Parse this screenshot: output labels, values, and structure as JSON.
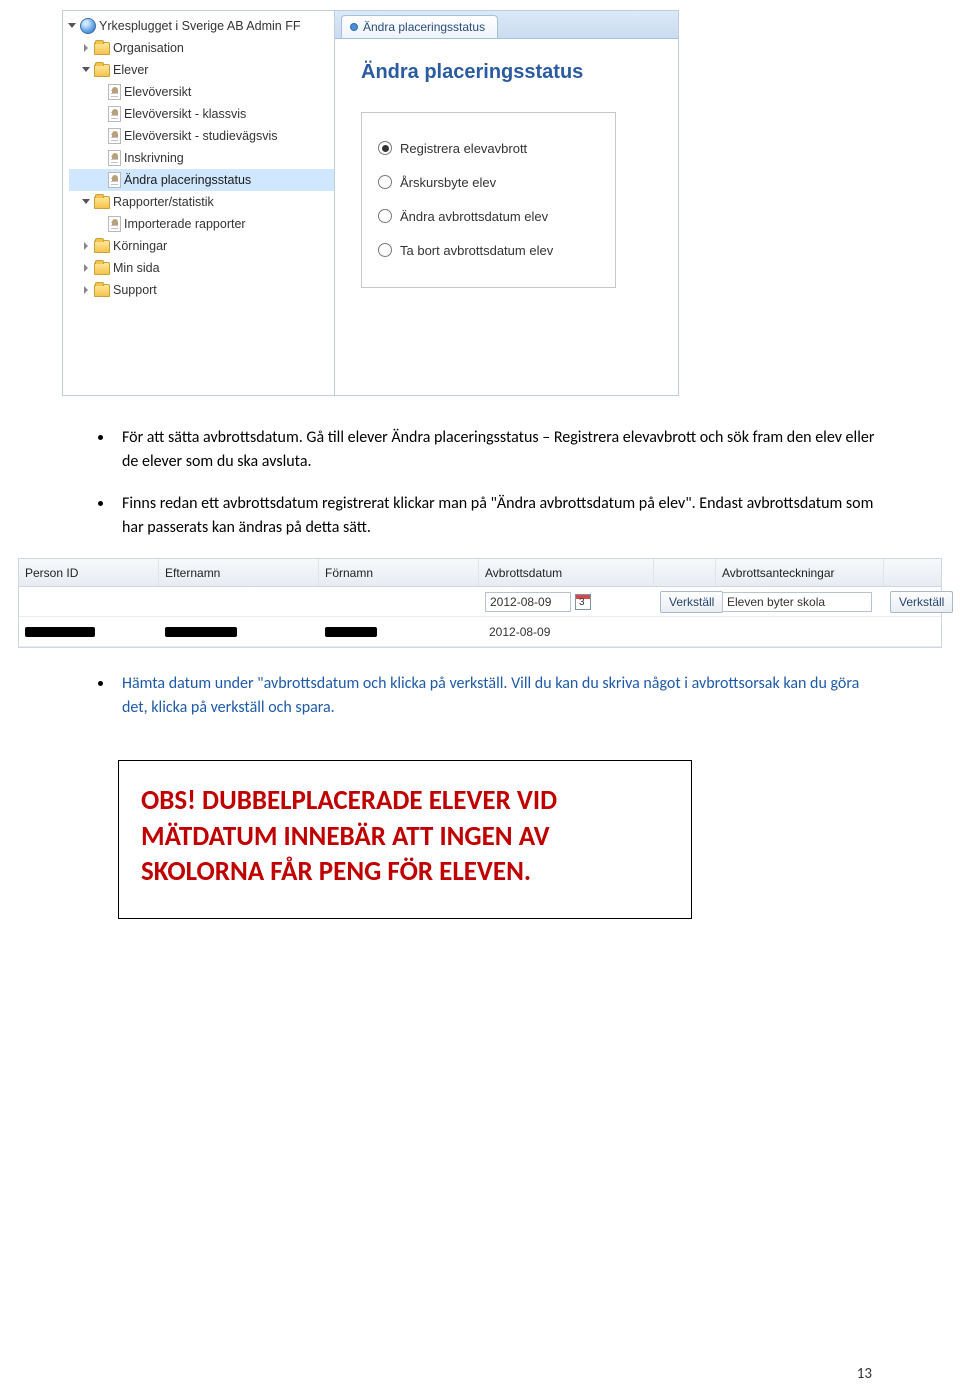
{
  "tree": {
    "root": "Yrkesplugget i Sverige AB Admin FF",
    "items": [
      {
        "label": "Organisation",
        "type": "folder",
        "caret": "right",
        "level": 2
      },
      {
        "label": "Elever",
        "type": "folder",
        "caret": "down",
        "level": 2
      },
      {
        "label": "Elevöversikt",
        "type": "doc",
        "caret": "none",
        "level": 3
      },
      {
        "label": "Elevöversikt - klassvis",
        "type": "doc",
        "caret": "none",
        "level": 3
      },
      {
        "label": "Elevöversikt - studievägsvis",
        "type": "doc",
        "caret": "none",
        "level": 3
      },
      {
        "label": "Inskrivning",
        "type": "doc",
        "caret": "none",
        "level": 3
      },
      {
        "label": "Ändra placeringsstatus",
        "type": "doc",
        "caret": "none",
        "level": 3,
        "selected": 1
      },
      {
        "label": "Rapporter/statistik",
        "type": "folder",
        "caret": "down",
        "level": 2
      },
      {
        "label": "Importerade rapporter",
        "type": "doc",
        "caret": "none",
        "level": 3
      },
      {
        "label": "Körningar",
        "type": "folder",
        "caret": "right",
        "level": 2
      },
      {
        "label": "Min sida",
        "type": "folder",
        "caret": "right",
        "level": 2
      },
      {
        "label": "Support",
        "type": "folder",
        "caret": "right",
        "level": 2
      }
    ]
  },
  "tab": {
    "label": "Ändra placeringsstatus"
  },
  "panel": {
    "title": "Ändra placeringsstatus",
    "radios": [
      {
        "label": "Registrera elevavbrott",
        "on": 1
      },
      {
        "label": "Årskursbyte elev",
        "on": 0
      },
      {
        "label": "Ändra avbrottsdatum elev",
        "on": 0
      },
      {
        "label": "Ta bort avbrottsdatum elev",
        "on": 0
      }
    ]
  },
  "body": {
    "b1": "För att sätta avbrottsdatum. Gå till elever Ändra placeringsstatus – Registrera elevavbrott och sök fram den elev eller de elever som du ska avsluta.",
    "b2": "Finns redan ett avbrottsdatum registrerat klickar man på \"Ändra avbrottsdatum på elev\". Endast avbrottsdatum som har passerats kan ändras på detta sätt.",
    "b3a": "Hämta datum under \"avbrottsdatum och klicka på verkställ. Vill du kan du skriva något i avbrottsorsak kan du göra det, klicka på verkställ och spara.",
    "callout": "OBS! DUBBELPLACERADE ELEVER VID MÄTDATUM INNEBÄR ATT INGEN AV SKOLORNA FÅR PENG FÖR ELEVEN.",
    "page": "13"
  },
  "table": {
    "headers": {
      "personid": "Person ID",
      "efternamn": "Efternamn",
      "fornamn": "Förnamn",
      "avbrottsdatum": "Avbrottsdatum",
      "verk1": "",
      "anteckningar": "Avbrottsanteckningar",
      "verk2": ""
    },
    "row1": {
      "date": "2012-08-09",
      "verk": "Verkställ",
      "notes": "Eleven byter skola",
      "verk2": "Verkställ"
    },
    "row2": {
      "date": "2012-08-09"
    }
  }
}
